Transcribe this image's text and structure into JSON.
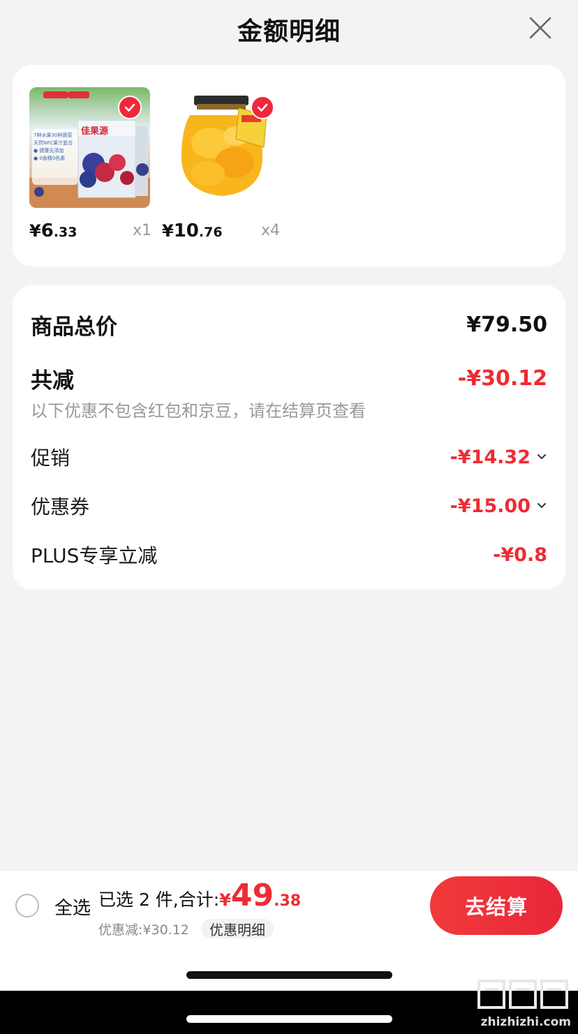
{
  "header": {
    "title": "金额明细"
  },
  "products": [
    {
      "price_yen": "¥",
      "price_int": "6",
      "price_dec": ".33",
      "qty": "x1",
      "selected": true,
      "image": "juice-box-image"
    },
    {
      "price_yen": "¥",
      "price_int": "10",
      "price_dec": ".76",
      "qty": "x4",
      "selected": true,
      "image": "canned-peach-jar-image"
    }
  ],
  "product_images": {
    "juice_brand": "佳果源",
    "juice_tagline": "7种水果30种蔬菜",
    "juice_lines": [
      "天然NFC果汁复合",
      "● 健康无添加",
      "● 0香精0色素"
    ]
  },
  "details": {
    "subtotal_label": "商品总价",
    "subtotal_value": "¥79.50",
    "total_reduction_label": "共减",
    "total_reduction_value": "-¥30.12",
    "note": "以下优惠不包含红包和京豆，请在结算页查看",
    "promo_label": "促销",
    "promo_value": "-¥14.32",
    "coupon_label": "优惠券",
    "coupon_value": "-¥15.00",
    "plus_label": "PLUS专享立减",
    "plus_value": "-¥0.8"
  },
  "bottom": {
    "select_all": "全选",
    "selected_summary": "已选 2 件,合计:",
    "total_yen": "¥",
    "total_int": "49",
    "total_dec": ".38",
    "discount_line": "优惠减:¥30.12",
    "detail_link": "优惠明细",
    "checkout": "去结算"
  },
  "watermark": {
    "text": "zhizhizhi.com"
  },
  "colors": {
    "accent": "#ee2b34",
    "background": "#f3f3f3"
  }
}
